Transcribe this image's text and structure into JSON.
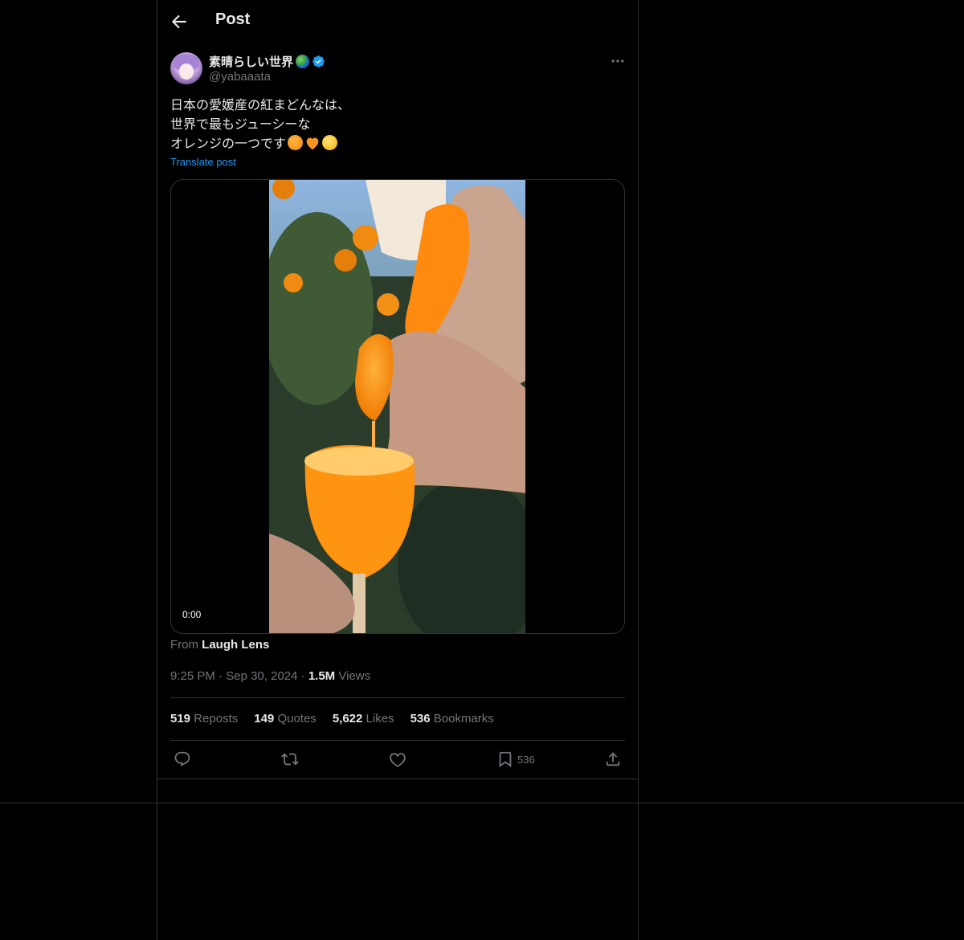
{
  "header": {
    "title": "Post"
  },
  "author": {
    "name": "素晴らしい世界",
    "handle": "@yabaaata"
  },
  "post": {
    "text": "日本の愛媛産の紅まどんなは、\n世界で最もジューシーな\nオレンジの一つです",
    "translate_label": "Translate post"
  },
  "media": {
    "time": "0:00"
  },
  "source": {
    "prefix": "From",
    "name": "Laugh Lens"
  },
  "meta": {
    "time": "9:25 PM",
    "date": "Sep 30, 2024",
    "views": "1.5M",
    "views_label": "Views"
  },
  "stats": {
    "reposts": "519",
    "reposts_label": "Reposts",
    "quotes": "149",
    "quotes_label": "Quotes",
    "likes": "5,622",
    "likes_label": "Likes",
    "bookmarks": "536",
    "bookmarks_label": "Bookmarks"
  },
  "actions": {
    "bookmark_count": "536"
  },
  "icons": [
    "back-arrow-icon",
    "globe-emoji-icon",
    "verified-badge-icon",
    "more-options-icon",
    "reply-icon",
    "repost-icon",
    "like-icon",
    "bookmark-icon",
    "share-icon"
  ],
  "colors": {
    "background": "#000000",
    "text": "#e7e9ea",
    "muted": "#71767b",
    "accent": "#1d9bf0",
    "border": "#2f3336"
  }
}
